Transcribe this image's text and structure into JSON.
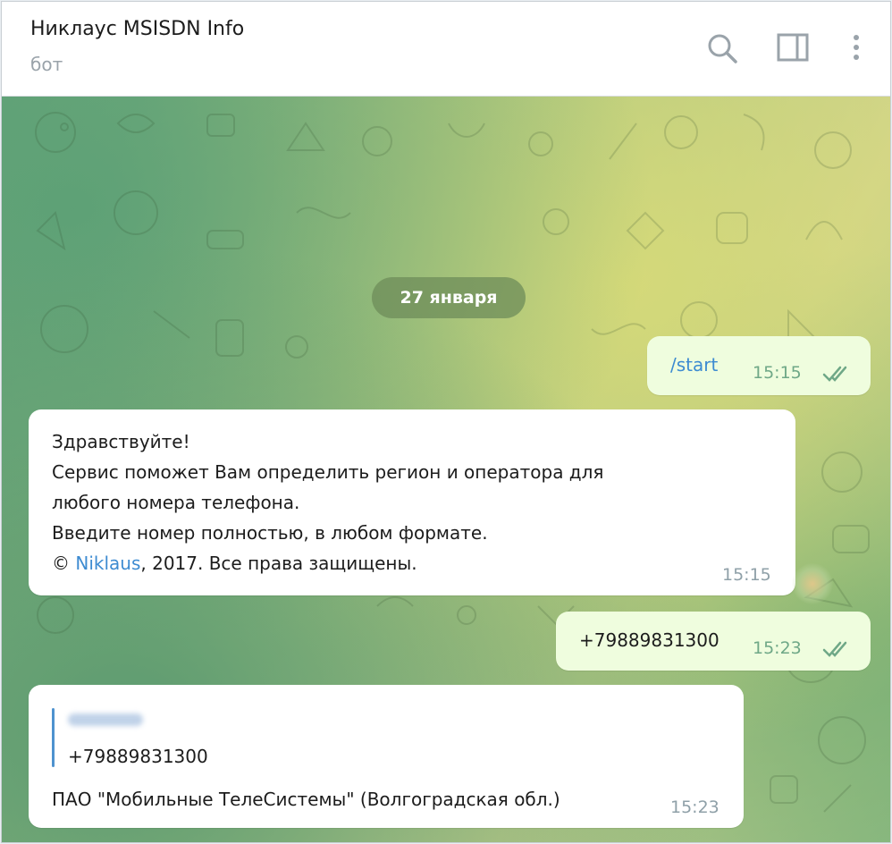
{
  "header": {
    "title": "Никлаус MSISDN Info",
    "subtitle": "бот",
    "icons": [
      "search-icon",
      "sidebar-panel-icon",
      "more-vertical-icon"
    ]
  },
  "chat": {
    "date_separator": "27 января",
    "messages": [
      {
        "direction": "outgoing",
        "text": "/start",
        "time": "15:15",
        "status": "read"
      },
      {
        "direction": "incoming",
        "lines": [
          "Здравствуйте!",
          "Сервис поможет Вам определить регион и оператора для",
          "любого номера телефона.",
          "Введите номер полностью, в любом формате."
        ],
        "copyright": {
          "symbol": "©",
          "link": "Niklaus",
          "rest": ", 2017. Все права защищены."
        },
        "time": "15:15"
      },
      {
        "direction": "outgoing",
        "text": "+79889831300",
        "time": "15:23",
        "status": "read"
      },
      {
        "direction": "incoming",
        "quote": {
          "text": "+79889831300"
        },
        "text": "ПАО \"Мобильные ТелеСистемы\" (Волгоградская обл.)",
        "time": "15:23"
      }
    ]
  },
  "colors": {
    "outgoing_bubble": "#effdde",
    "incoming_bubble": "#ffffff",
    "link": "#3d8bd1",
    "read_ticks": "#6fa887",
    "date_pill": "#6e8c5a"
  }
}
